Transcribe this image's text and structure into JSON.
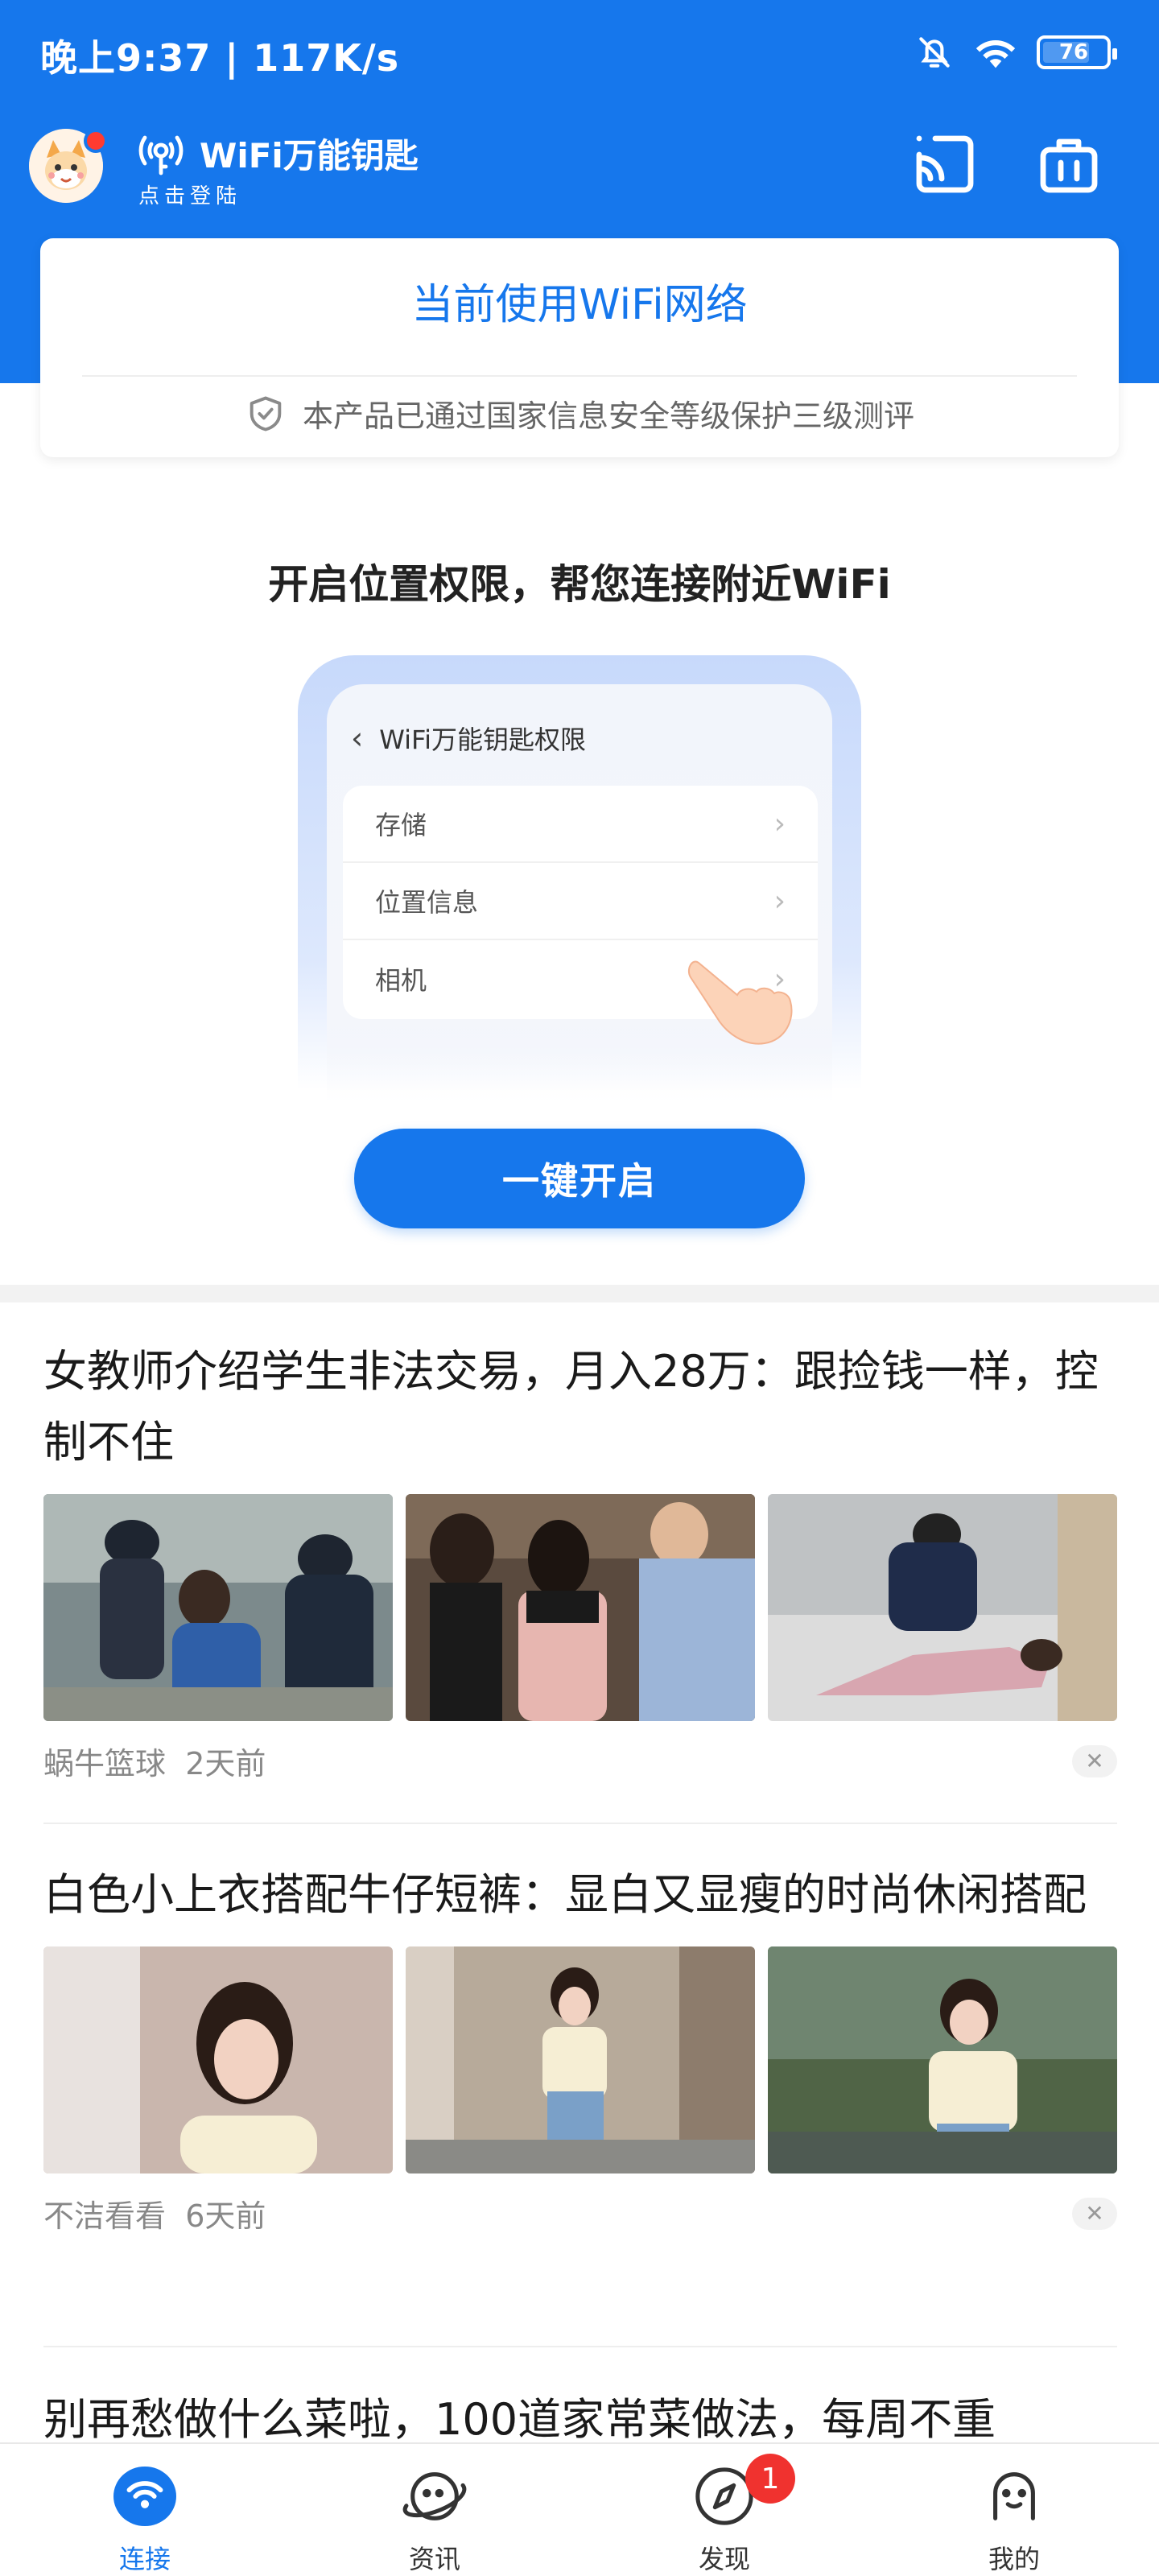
{
  "status_bar": {
    "time": "晚上9:37 | 117K/s",
    "battery": "76",
    "icons": [
      "bell-muted-icon",
      "wifi-icon",
      "battery-icon"
    ]
  },
  "header": {
    "app_name": "WiFi万能钥匙",
    "login_hint": "点击登陆",
    "icons": [
      "avatar",
      "wifi-key-logo-icon",
      "scan-icon",
      "toolbox-icon"
    ]
  },
  "network_card": {
    "title": "当前使用WiFi网络",
    "certification": "本产品已通过国家信息安全等级保护三级测评"
  },
  "permission": {
    "title": "开启位置权限，帮您连接附近WiFi",
    "illustration_header": "WiFi万能钥匙权限",
    "items": [
      "存储",
      "位置信息",
      "相机"
    ],
    "button": "一键开启"
  },
  "news": [
    {
      "title": "女教师介绍学生非法交易，月入28万：跟捡钱一样，控制不住",
      "source": "蜗牛篮球",
      "time": "2天前"
    },
    {
      "title": "白色小上衣搭配牛仔短裤：显白又显瘦的时尚休闲搭配",
      "source": "不洁看看",
      "time": "6天前"
    },
    {
      "title": "别再愁做什么菜啦，100道家常菜做法，每周不重"
    }
  ],
  "bottom_nav": {
    "items": [
      {
        "label": "连接",
        "icon": "wifi-icon",
        "active": true
      },
      {
        "label": "资讯",
        "icon": "chat-planet-icon"
      },
      {
        "label": "发现",
        "icon": "compass-icon",
        "badge": "1"
      },
      {
        "label": "我的",
        "icon": "profile-icon"
      }
    ]
  },
  "colors": {
    "brand_blue": "#1677ec",
    "badge_red": "#f0322f"
  }
}
